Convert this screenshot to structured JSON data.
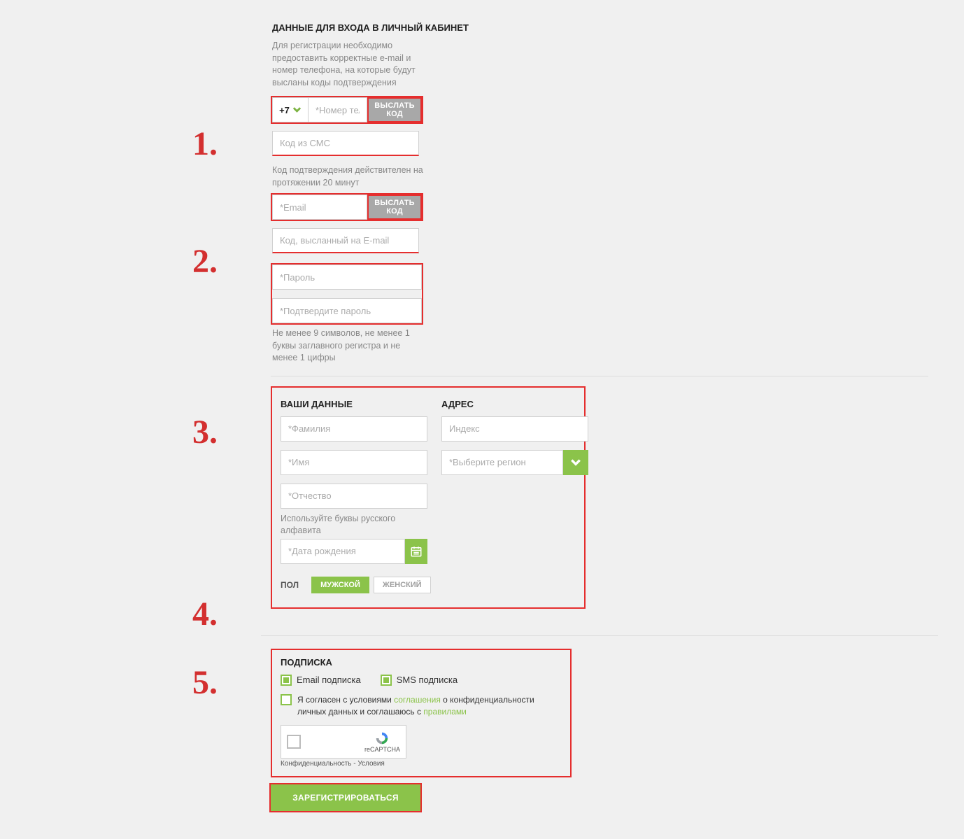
{
  "annotations": {
    "n1": "1.",
    "n2": "2.",
    "n3": "3.",
    "n4": "4.",
    "n5": "5."
  },
  "section1": {
    "heading": "ДАННЫЕ ДЛЯ ВХОДА В ЛИЧНЫЙ КАБИНЕТ",
    "intro": "Для регистрации необходимо предоставить корректные e-mail и номер телефона, на которые будут высланы коды подтверждения",
    "phone_prefix": "+7",
    "phone_placeholder": "*Номер телефона",
    "send_code_btn": "ВЫСЛАТЬ КОД",
    "sms_code_placeholder": "Код из СМС",
    "code_valid_hint": "Код подтверждения действителен на протяжении 20 минут",
    "email_placeholder": "*Email",
    "send_code_btn2": "ВЫСЛАТЬ КОД",
    "email_code_placeholder": "Код, высланный на E-mail",
    "password_placeholder": "*Пароль",
    "password_confirm_placeholder": "*Подтвердите пароль",
    "password_hint": "Не менее 9 символов, не менее 1 буквы заглавного регистра и не менее 1 цифры"
  },
  "section2": {
    "left_heading": "ВАШИ ДАННЫЕ",
    "right_heading": "АДРЕС",
    "surname_placeholder": "*Фамилия",
    "name_placeholder": "*Имя",
    "patronymic_placeholder": "*Отчество",
    "alpha_hint": "Используйте буквы русского алфавита",
    "dob_placeholder": "*Дата рождения",
    "index_placeholder": "Индекс",
    "region_placeholder": "*Выберите регион",
    "pol_label": "ПОЛ",
    "male_label": "МУЖСКОЙ",
    "female_label": "ЖЕНСКИЙ"
  },
  "section3": {
    "heading": "ПОДПИСКА",
    "email_sub": "Email подписка",
    "sms_sub": "SMS подписка",
    "agree_pre": "Я согласен с условиями ",
    "agree_link1": "соглашения",
    "agree_mid": " о конфиденциальности личных данных и соглашаюсь с ",
    "agree_link2": "правилами",
    "recaptcha_label": "reCAPTCHA",
    "recaptcha_terms": "Конфиденциальность - Условия"
  },
  "register_btn": "ЗАРЕГИСТРИРОВАТЬСЯ"
}
